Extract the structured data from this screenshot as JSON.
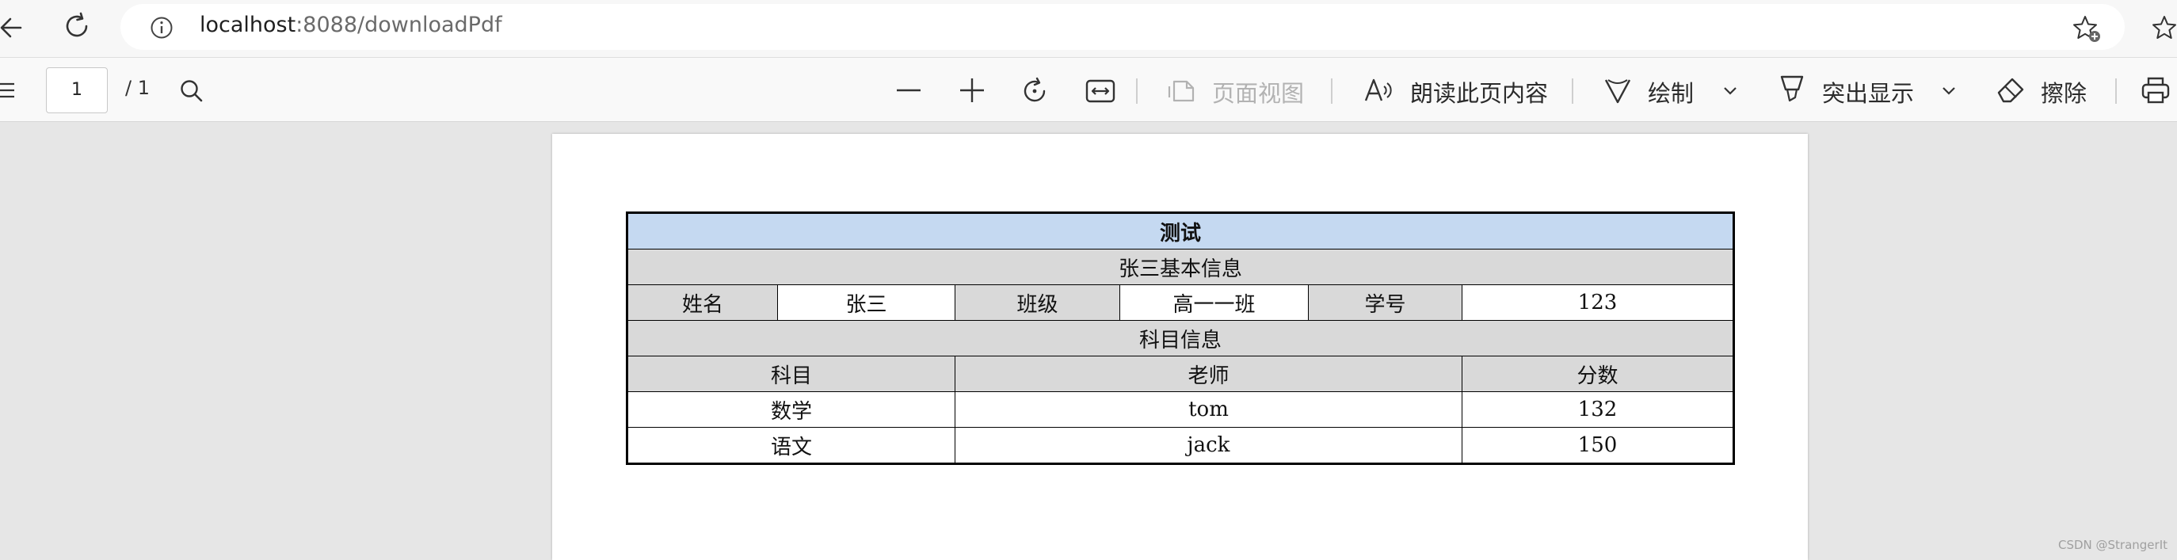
{
  "address_bar": {
    "url_host": "localhost",
    "url_path": ":8088/downloadPdf"
  },
  "toolbar": {
    "page_number": "1",
    "page_total": "/ 1",
    "page_view_label": "页面视图",
    "read_aloud_label": "朗读此页内容",
    "draw_label": "绘制",
    "highlight_label": "突出显示",
    "erase_label": "擦除"
  },
  "document": {
    "table": {
      "title": "测试",
      "basic_section_title": "张三基本信息",
      "basic_info": [
        {
          "label": "姓名",
          "value": "张三"
        },
        {
          "label": "班级",
          "value": "高一一班"
        },
        {
          "label": "学号",
          "value": "123"
        }
      ],
      "subject_section_title": "科目信息",
      "columns": [
        "科目",
        "老师",
        "分数"
      ],
      "rows": [
        [
          "数学",
          "tom",
          "132"
        ],
        [
          "语文",
          "jack",
          "150"
        ]
      ]
    }
  },
  "watermark": "CSDN @StrangerIt",
  "icons": [
    "back-arrow-icon",
    "reload-icon",
    "site-info-icon",
    "favorite-add-icon",
    "favorites-icon",
    "contents-menu-icon",
    "search-icon",
    "zoom-out-icon",
    "zoom-in-icon",
    "rotate-icon",
    "fit-width-icon",
    "page-view-icon",
    "read-aloud-icon",
    "draw-icon",
    "chevron-down-icon",
    "highlight-icon",
    "eraser-icon",
    "print-icon"
  ]
}
